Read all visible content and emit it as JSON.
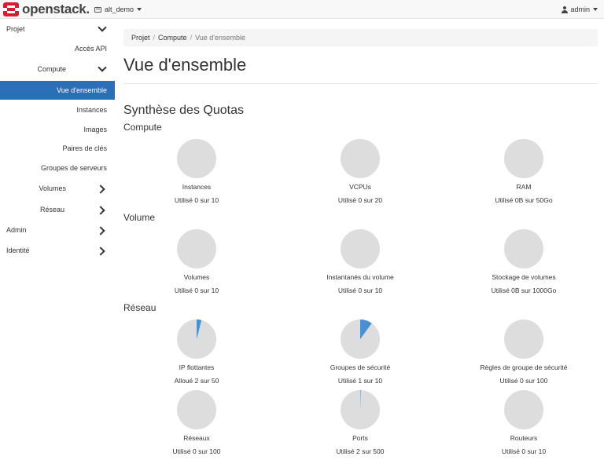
{
  "header": {
    "logo_text": "openstack.",
    "project": "alt_demo",
    "user": "admin"
  },
  "colors": {
    "accent": "#2a6fb8",
    "pie_empty": "#dddddd",
    "pie_fill": "#4a8fd1"
  },
  "sidebar": {
    "items": [
      {
        "label": "Projet"
      },
      {
        "label": "Accès API"
      },
      {
        "label": "Compute"
      },
      {
        "label": "Vue d'ensemble"
      },
      {
        "label": "Instances"
      },
      {
        "label": "Images"
      },
      {
        "label": "Paires de clés"
      },
      {
        "label": "Groupes de serveurs"
      },
      {
        "label": "Volumes"
      },
      {
        "label": "Réseau"
      },
      {
        "label": "Admin"
      },
      {
        "label": "Identité"
      }
    ]
  },
  "breadcrumb": [
    "Projet",
    "Compute",
    "Vue d'ensemble"
  ],
  "page_title": "Vue d'ensemble",
  "section_title": "Synthèse des Quotas",
  "groups": [
    {
      "title": "Compute",
      "quotas": [
        {
          "label": "Instances",
          "usage": "Utilisé 0 sur 10",
          "used": 0,
          "total": 10
        },
        {
          "label": "VCPUs",
          "usage": "Utilisé 0 sur 20",
          "used": 0,
          "total": 20
        },
        {
          "label": "RAM",
          "usage": "Utilisé 0B sur 50Go",
          "used": 0,
          "total": 50
        }
      ]
    },
    {
      "title": "Volume",
      "quotas": [
        {
          "label": "Volumes",
          "usage": "Utilisé 0 sur 10",
          "used": 0,
          "total": 10
        },
        {
          "label": "Instantanés du volume",
          "usage": "Utilisé 0 sur 10",
          "used": 0,
          "total": 10
        },
        {
          "label": "Stockage de volumes",
          "usage": "Utilisé 0B sur 1000Go",
          "used": 0,
          "total": 1000
        }
      ]
    },
    {
      "title": "Réseau",
      "quotas": [
        {
          "label": "IP flottantes",
          "usage": "Alloué 2 sur 50",
          "used": 2,
          "total": 50
        },
        {
          "label": "Groupes de sécurité",
          "usage": "Utilisé 1 sur 10",
          "used": 1,
          "total": 10
        },
        {
          "label": "Règles de groupe de sécurité",
          "usage": "Utilisé 0 sur 100",
          "used": 0,
          "total": 100
        },
        {
          "label": "Réseaux",
          "usage": "Utilisé 0 sur 100",
          "used": 0,
          "total": 100
        },
        {
          "label": "Ports",
          "usage": "Utilisé 2 sur 500",
          "used": 2,
          "total": 500
        },
        {
          "label": "Routeurs",
          "usage": "Utilisé 0 sur 10",
          "used": 0,
          "total": 10
        }
      ]
    }
  ]
}
